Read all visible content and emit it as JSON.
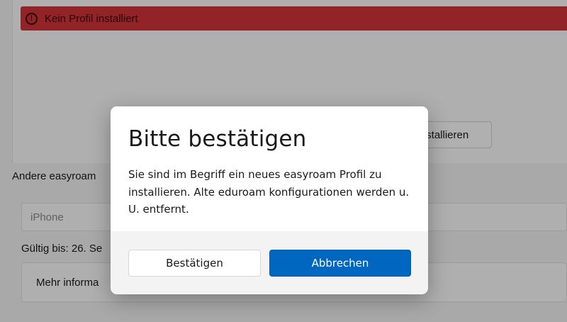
{
  "background": {
    "error_banner": {
      "icon": "error-circle-icon",
      "text": "Kein Profil installiert"
    },
    "install_button_text": "nstallieren",
    "other_label": "Andere easyroam",
    "device_input": {
      "placeholder": "iPhone"
    },
    "valid_until": "Gültig bis: 26. Se",
    "more_info": "Mehr informa"
  },
  "dialog": {
    "title": "Bitte bestätigen",
    "message": "Sie sind im Begriff ein neues easyroam Profil zu installieren. Alte eduroam konfigurationen werden u. U. entfernt.",
    "confirm_label": "Bestätigen",
    "cancel_label": "Abbrechen"
  },
  "colors": {
    "error": "#d13438",
    "accent": "#0067c0",
    "overlay": "rgba(0,0,0,0.30)"
  }
}
